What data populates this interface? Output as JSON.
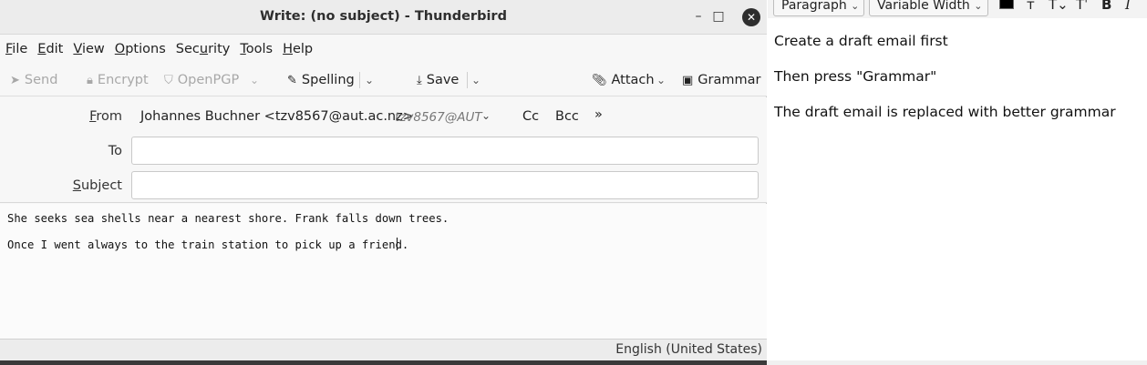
{
  "window": {
    "title": "Write: (no subject) - Thunderbird",
    "controls": {
      "minimize": "–",
      "maximize": "□",
      "close": "✕"
    }
  },
  "menu": {
    "items": [
      {
        "u": "F",
        "rest": "ile"
      },
      {
        "u": "E",
        "rest": "dit"
      },
      {
        "u": "V",
        "rest": "iew"
      },
      {
        "pre": "",
        "u": "O",
        "rest": "ptions"
      },
      {
        "pre": "Sec",
        "u": "u",
        "rest": "rity"
      },
      {
        "u": "T",
        "rest": "ools"
      },
      {
        "u": "H",
        "rest": "elp"
      }
    ]
  },
  "toolbar": {
    "send": "Send",
    "encrypt": "Encrypt",
    "openpgp": "OpenPGP",
    "spelling": "Spelling",
    "save": "Save",
    "attach": "Attach",
    "grammar": "Grammar"
  },
  "headers": {
    "from_label_u": "F",
    "from_label_rest": "rom",
    "from_value": "Johannes Buchner <tzv8567@aut.ac.nz>",
    "from_identity": "tzv8567@AUT",
    "cc": "Cc",
    "bcc": "Bcc",
    "more": "»",
    "to_label": "To",
    "to_value": "",
    "subject_label_u": "S",
    "subject_label_rest": "ubject",
    "subject_value": ""
  },
  "body": {
    "line1": "She seeks sea shells near a nearest shore. Frank falls down trees.",
    "line2": "Once I went always to the train station to pick up a friend."
  },
  "status": {
    "language": "English (United States)"
  },
  "editor": {
    "paragraph_select": "Paragraph",
    "font_select": "Variable Width",
    "text_color": "#000000",
    "paragraphs": [
      "Create a draft email first",
      "Then press \"Grammar\"",
      "The draft email is replaced with better grammar"
    ]
  },
  "icons": {
    "send": "send-icon",
    "encrypt": "lock-icon",
    "openpgp": "shield-icon",
    "spelling": "spelling-icon",
    "save": "download-icon",
    "attach": "paperclip-icon",
    "grammar": "book-icon"
  }
}
